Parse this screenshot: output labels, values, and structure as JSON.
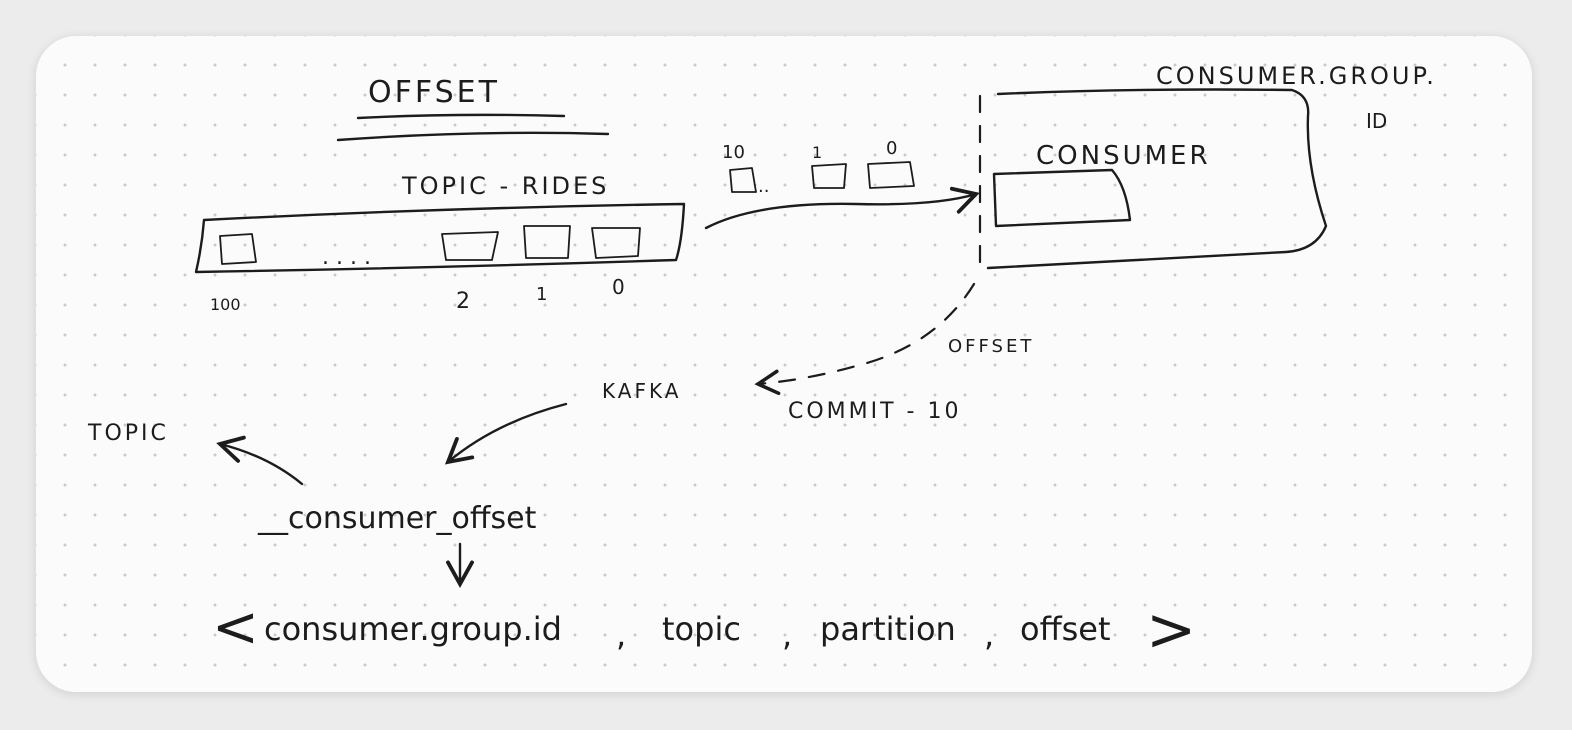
{
  "title": "OFFSET",
  "topic_label": "TOPIC - RIDES",
  "topic_numbers": {
    "first": "100",
    "dots": ". . . .",
    "two": "2",
    "one": "1",
    "zero": "0"
  },
  "flow_numbers": {
    "ten": "10",
    "dots": "..",
    "one": "1",
    "zero": "0"
  },
  "consumer_group_label": "CONSUMER.GROUP.",
  "consumer_group_id": "ID",
  "consumer_label": "CONSUMER",
  "commit_label": "COMMIT - 10",
  "offset_label": "OFFSET",
  "kafka_label": "KAFKA",
  "topic_side_label": "TOPIC",
  "internal_topic": "__consumer_offset",
  "tuple": {
    "open": "<",
    "consumer_group_id": "consumer.group.id",
    "sep1": ",",
    "topic": "topic",
    "sep2": ",",
    "partition": "partition",
    "sep3": ",",
    "offset": "offset",
    "close": ">"
  }
}
